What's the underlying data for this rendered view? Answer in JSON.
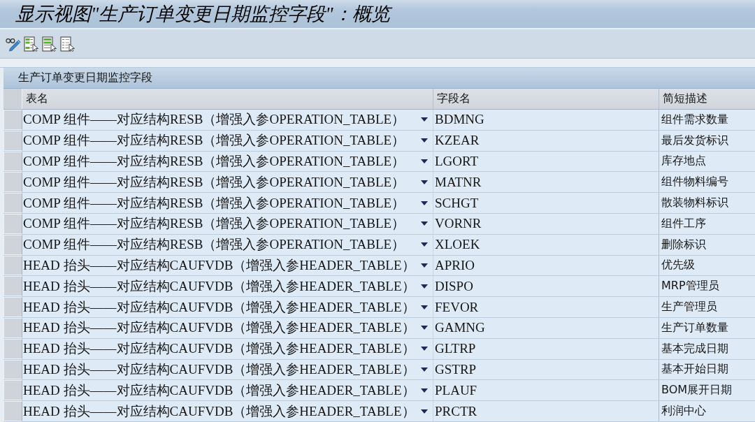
{
  "title": "显示视图\"生产订单变更日期监控字段\"：概览",
  "panel": {
    "title": "生产订单变更日期监控字段",
    "columns": [
      "表名",
      "字段名",
      "简短描述"
    ],
    "rows": [
      {
        "table": "COMP 组件——对应结构RESB（增强入参OPERATION_TABLE）",
        "field": "BDMNG",
        "description": "组件需求数量",
        "selected": false
      },
      {
        "table": "COMP 组件——对应结构RESB（增强入参OPERATION_TABLE）",
        "field": "KZEAR",
        "description": "最后发货标识",
        "selected": false
      },
      {
        "table": "COMP 组件——对应结构RESB（增强入参OPERATION_TABLE）",
        "field": "LGORT",
        "description": "库存地点",
        "selected": false
      },
      {
        "table": "COMP 组件——对应结构RESB（增强入参OPERATION_TABLE）",
        "field": "MATNR",
        "description": "组件物料编号",
        "selected": false
      },
      {
        "table": "COMP 组件——对应结构RESB（增强入参OPERATION_TABLE）",
        "field": "SCHGT",
        "description": "散装物料标识",
        "selected": false
      },
      {
        "table": "COMP 组件——对应结构RESB（增强入参OPERATION_TABLE）",
        "field": "VORNR",
        "description": "组件工序",
        "selected": false
      },
      {
        "table": "COMP 组件——对应结构RESB（增强入参OPERATION_TABLE）",
        "field": "XLOEK",
        "description": "删除标识",
        "selected": false
      },
      {
        "table": "HEAD 抬头——对应结构CAUFVDB（增强入参HEADER_TABLE）",
        "field": "APRIO",
        "description": "优先级",
        "selected": false
      },
      {
        "table": "HEAD 抬头——对应结构CAUFVDB（增强入参HEADER_TABLE）",
        "field": "DISPO",
        "description": "MRP管理员",
        "selected": false
      },
      {
        "table": "HEAD 抬头——对应结构CAUFVDB（增强入参HEADER_TABLE）",
        "field": "FEVOR",
        "description": "生产管理员",
        "selected": false
      },
      {
        "table": "HEAD 抬头——对应结构CAUFVDB（增强入参HEADER_TABLE）",
        "field": "GAMNG",
        "description": "生产订单数量",
        "selected": false
      },
      {
        "table": "HEAD 抬头——对应结构CAUFVDB（增强入参HEADER_TABLE）",
        "field": "GLTRP",
        "description": "基本完成日期",
        "selected": false
      },
      {
        "table": "HEAD 抬头——对应结构CAUFVDB（增强入参HEADER_TABLE）",
        "field": "GSTRP",
        "description": "基本开始日期",
        "selected": false
      },
      {
        "table": "HEAD 抬头——对应结构CAUFVDB（增强入参HEADER_TABLE）",
        "field": "PLAUF",
        "description": "BOM展开日期",
        "selected": false
      },
      {
        "table": "HEAD 抬头——对应结构CAUFVDB（增强入参HEADER_TABLE）",
        "field": "PRCTR",
        "description": "利润中心",
        "selected": false
      }
    ]
  }
}
